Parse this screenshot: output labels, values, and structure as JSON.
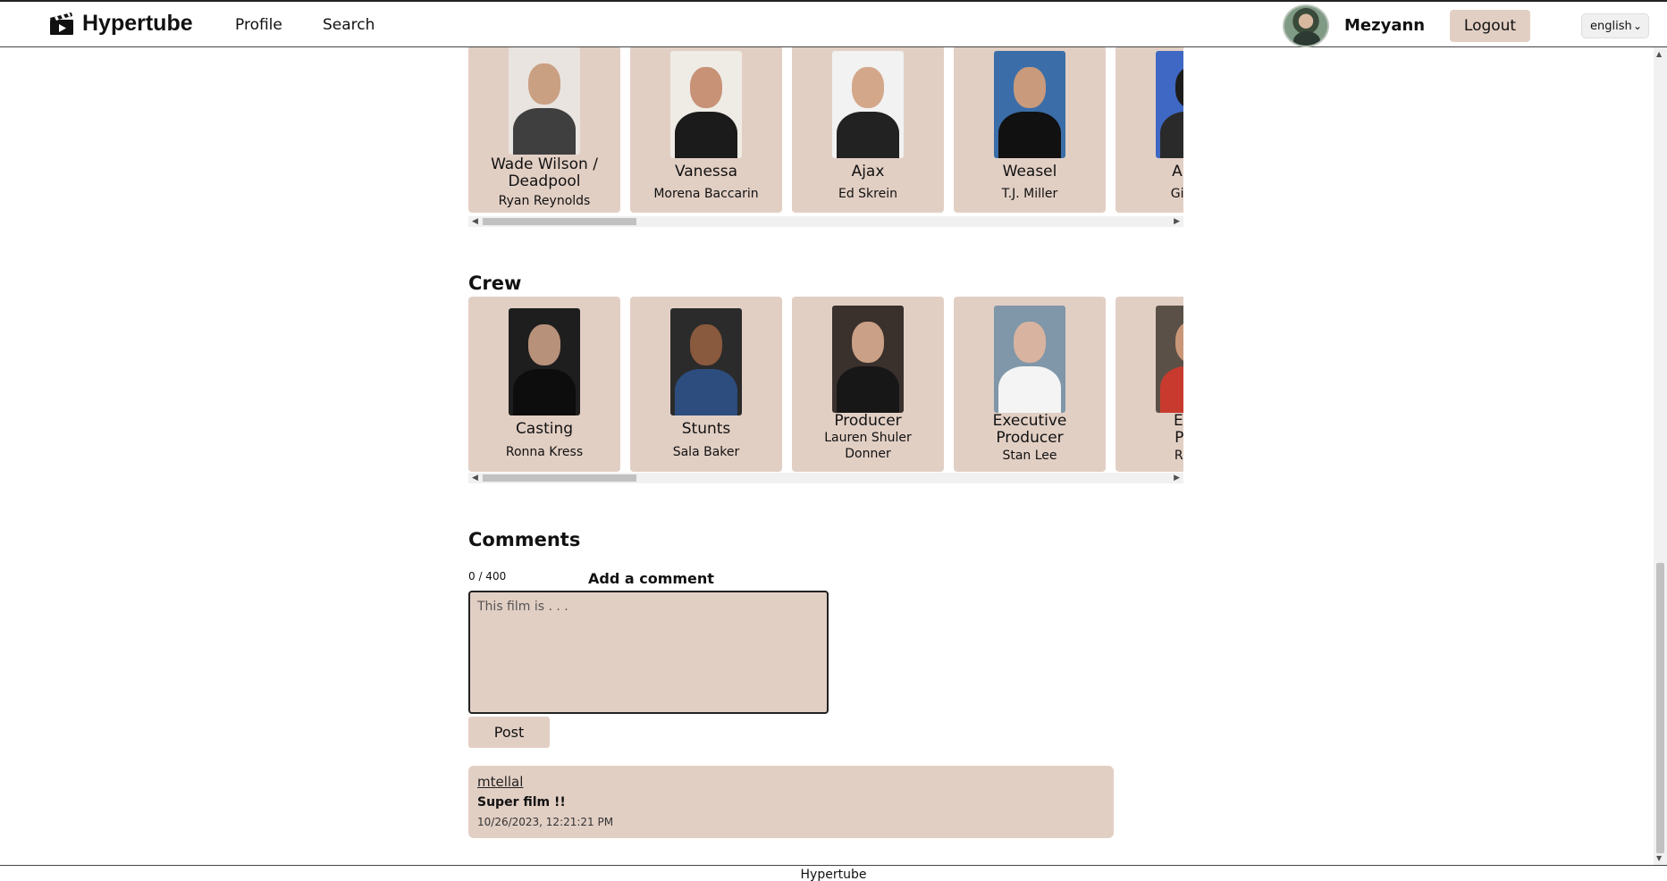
{
  "header": {
    "brand": "Hypertube",
    "nav": {
      "profile": "Profile",
      "search": "Search"
    },
    "username": "Mezyann",
    "logout_label": "Logout",
    "language": "english"
  },
  "cast": {
    "items": [
      {
        "role_line1": "Wade Wilson /",
        "role_line2": "Deadpool",
        "name": "Ryan Reynolds"
      },
      {
        "role_line1": "Vanessa",
        "role_line2": "",
        "name": "Morena Baccarin"
      },
      {
        "role_line1": "Ajax",
        "role_line2": "",
        "name": "Ed Skrein"
      },
      {
        "role_line1": "Weasel",
        "role_line2": "",
        "name": "T.J. Miller"
      },
      {
        "role_line1": "Ange",
        "role_line2": "",
        "name": "Gina C"
      }
    ]
  },
  "crew": {
    "title": "Crew",
    "items": [
      {
        "role_line1": "Casting",
        "role_line2": "",
        "name_line1": "Ronna Kress",
        "name_line2": ""
      },
      {
        "role_line1": "Stunts",
        "role_line2": "",
        "name_line1": "Sala Baker",
        "name_line2": ""
      },
      {
        "role_line1": "Producer",
        "role_line2": "",
        "name_line1": "Lauren Shuler",
        "name_line2": "Donner"
      },
      {
        "role_line1": "Executive",
        "role_line2": "Producer",
        "name_line1": "Stan Lee",
        "name_line2": ""
      },
      {
        "role_line1": "Exec",
        "role_line2": "Prod",
        "name_line1": "Rhett",
        "name_line2": ""
      }
    ]
  },
  "comments": {
    "title": "Comments",
    "char_count": "0 / 400",
    "add_label": "Add a comment",
    "placeholder": "This film is . . .",
    "post_label": "Post",
    "list": [
      {
        "user": "mtellal",
        "text": "Super film !!",
        "date": "10/26/2023, 12:21:21 PM"
      }
    ]
  },
  "footer": {
    "text": "Hypertube"
  },
  "colors": {
    "card_bg": "#e2cfc4",
    "accent": "#e2cfc4",
    "text": "#111111"
  }
}
